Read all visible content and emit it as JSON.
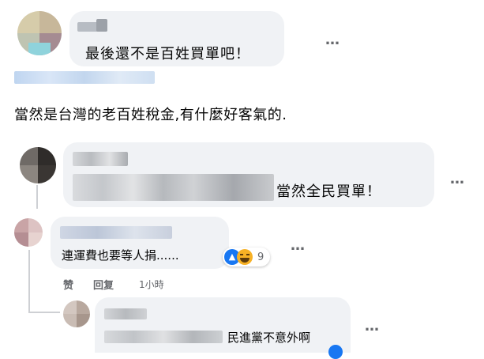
{
  "comments": [
    {
      "text": "最後還不是百姓買單吧！"
    },
    {
      "text": "當然是台灣的老百姓稅金,有什麼好客氣的."
    },
    {
      "text": "當然全民買單！"
    },
    {
      "text": "連運費也要等人捐......",
      "reaction_count": "9",
      "actions": {
        "like": "赞",
        "reply": "回复",
        "time": "1小時"
      }
    },
    {
      "text": "民進黨不意外啊"
    }
  ],
  "more_icon": "…",
  "icons": [
    "like-reaction-icon",
    "haha-reaction-icon",
    "more-options-icon"
  ],
  "colors": {
    "bubble": "#f0f2f5",
    "text": "#050505",
    "meta": "#65676b",
    "like_blue": "#1877f2",
    "haha_yellow": "#f7b125",
    "thread": "#ced0d4"
  }
}
